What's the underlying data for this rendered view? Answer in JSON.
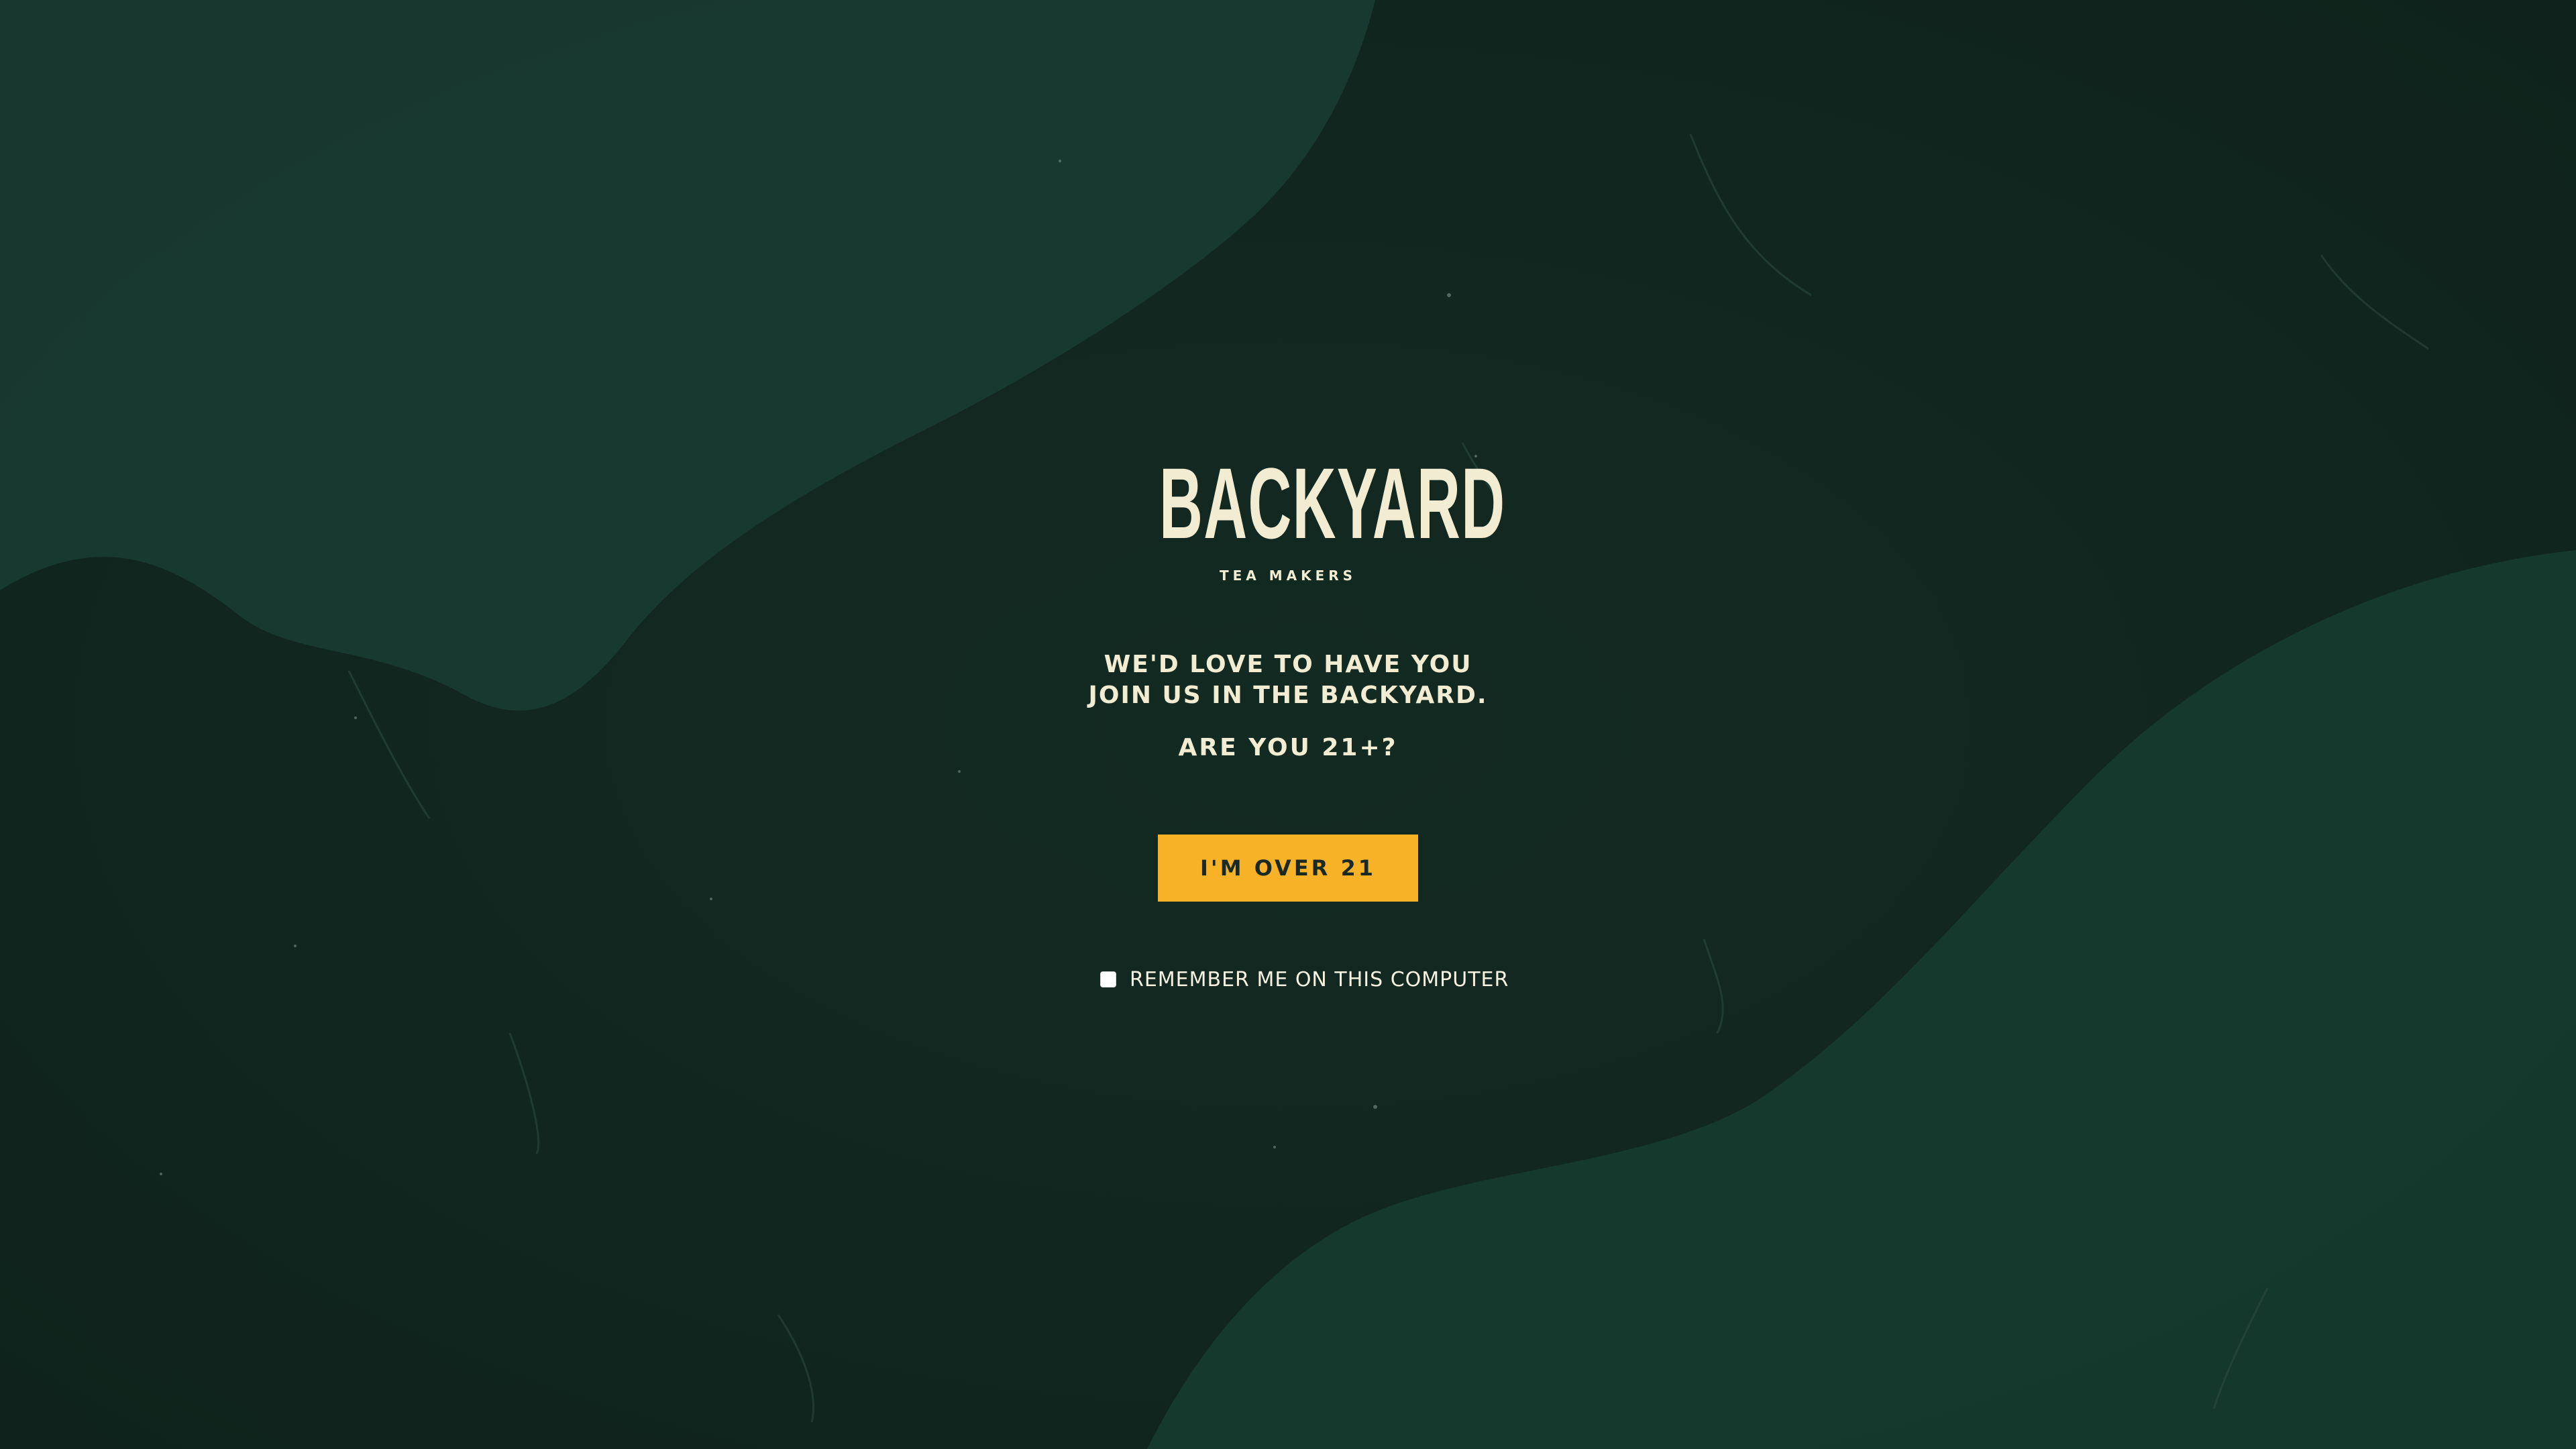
{
  "brand": {
    "name": "BACKYARD",
    "tagline": "TEA MAKERS"
  },
  "age_gate": {
    "headline_line1": "WE'D LOVE TO HAVE YOU",
    "headline_line2": "JOIN US IN THE BACKYARD.",
    "question": "ARE YOU 21+?",
    "confirm_button_label": "I'M OVER 21",
    "remember_label": "REMEMBER ME ON THIS COMPUTER",
    "remember_checked": false
  },
  "colors": {
    "background_dark": "#142a22",
    "background_light_shape": "#1a3a30",
    "text_cream": "#f1ecd2",
    "button_yellow": "#f7b227",
    "button_text": "#1b2a20"
  }
}
